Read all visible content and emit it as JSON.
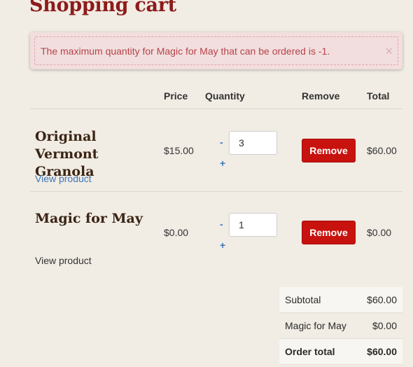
{
  "page": {
    "title": "Shopping cart"
  },
  "alert": {
    "message": "The maximum quantity for Magic for May that can be ordered is -1.",
    "close_icon": "×"
  },
  "table": {
    "headers": {
      "price": "Price",
      "quantity": "Quantity",
      "remove": "Remove",
      "total": "Total"
    },
    "rows": [
      {
        "name": "Original Vermont Granola",
        "link": "View product",
        "link_color": "#3d78b8",
        "price": "$15.00",
        "minus": "-",
        "plus": "+",
        "quantity": "3",
        "remove": "Remove",
        "total": "$60.00"
      },
      {
        "name": "Magic for May",
        "link": "View product",
        "link_color": "#333333",
        "price": "$0.00",
        "minus": "-",
        "plus": "+",
        "quantity": "1",
        "remove": "Remove",
        "total": "$0.00"
      }
    ]
  },
  "totals": [
    {
      "label": "Subtotal",
      "value": "$60.00"
    },
    {
      "label": "Magic for May",
      "value": "$0.00"
    },
    {
      "label": "Order total",
      "value": "$60.00"
    }
  ],
  "colors": {
    "background": "#f1ece4",
    "title": "#8c1b1b",
    "alert_bg": "#f2dede",
    "alert_text": "#b5434a",
    "remove_button": "#c8120e",
    "link": "#3d78b8"
  }
}
